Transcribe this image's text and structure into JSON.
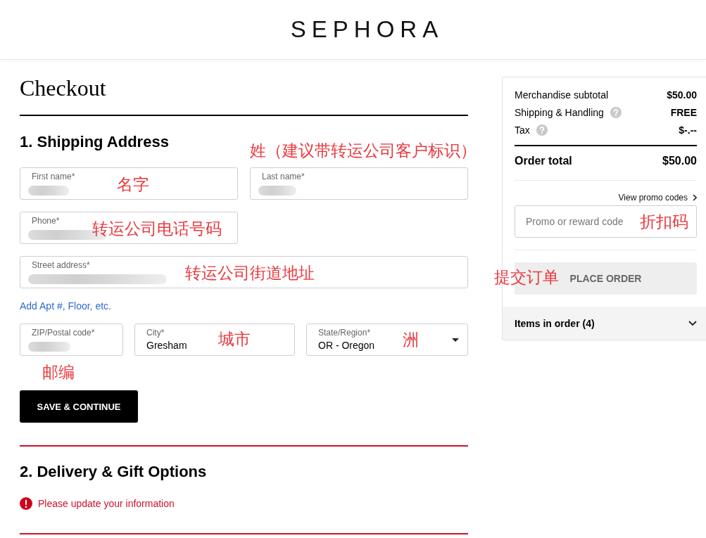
{
  "header": {
    "logo": "SEPHORA"
  },
  "checkout": {
    "title": "Checkout",
    "shipping": {
      "heading": "1. Shipping Address",
      "rows": [
        {
          "kind": "fields",
          "fields": [
            {
              "kind": "text",
              "label": "First name*",
              "blurred": true
            },
            {
              "kind": "text",
              "label": "Last name*",
              "blurred": true
            }
          ]
        },
        {
          "kind": "fields",
          "fields": [
            {
              "kind": "text",
              "label": "Phone*",
              "blurred": true
            }
          ]
        },
        {
          "kind": "fields",
          "fields": [
            {
              "kind": "text",
              "label": "Street address*",
              "blurred": true
            }
          ]
        },
        {
          "kind": "link",
          "text": "Add Apt #, Floor, etc."
        },
        {
          "kind": "fields",
          "fields": [
            {
              "kind": "text",
              "label": "ZIP/Postal code*",
              "blurred": true
            },
            {
              "kind": "text",
              "label": "City*",
              "value": "Gresham",
              "blurred": false
            },
            {
              "kind": "select",
              "label": "State/Region*",
              "value": "OR - Oregon",
              "blurred": false
            }
          ]
        }
      ],
      "button": "SAVE & CONTINUE"
    },
    "delivery": {
      "heading": "2. Delivery & Gift Options",
      "error": "Please update your information"
    }
  },
  "summary": {
    "lines": [
      {
        "label": "Merchandise subtotal",
        "value": "$50.00",
        "help": false
      },
      {
        "label": "Shipping & Handling",
        "value": "FREE",
        "help": true
      },
      {
        "label": "Tax",
        "value": "$-.--",
        "help": true
      }
    ],
    "total": {
      "label": "Order total",
      "value": "$50.00"
    },
    "promo_link": "View promo codes",
    "promo_field": {
      "placeholder": "Promo or reward code"
    },
    "place_order": {
      "label": "PLACE ORDER",
      "disabled": true
    },
    "items": {
      "label": "Items in order (4)",
      "expanded": false
    }
  },
  "annotations": [
    {
      "text": "姓（建议带转运公司客户标识）"
    },
    {
      "text": "名字"
    },
    {
      "text": "转运公司电话号码"
    },
    {
      "text": "转运公司街道地址"
    },
    {
      "text": "城市"
    },
    {
      "text": "洲"
    },
    {
      "text": "邮编"
    },
    {
      "text": "折扣码"
    },
    {
      "text": "提交订单"
    }
  ]
}
